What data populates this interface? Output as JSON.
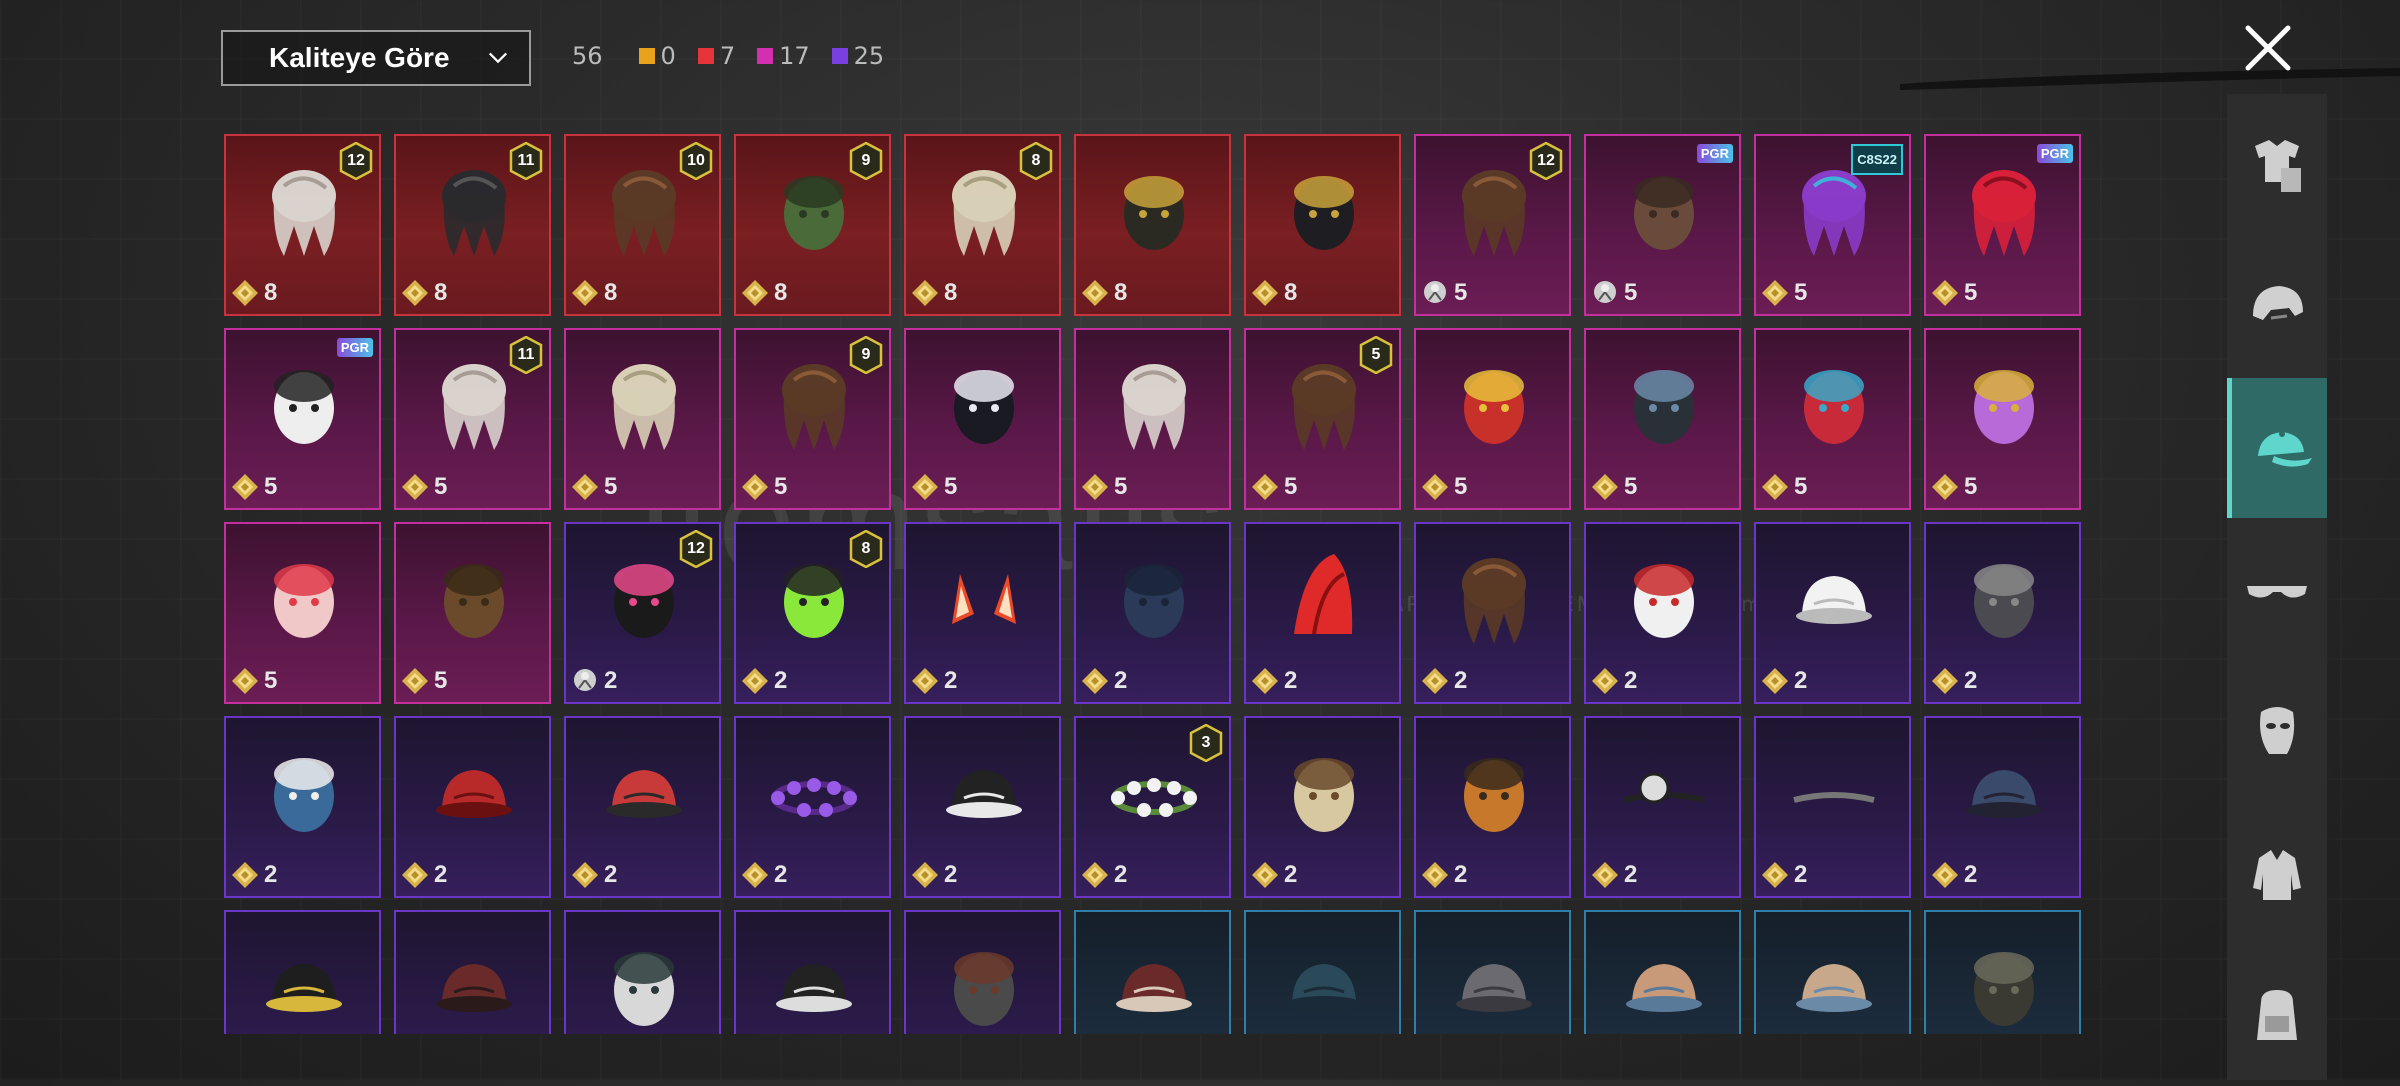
{
  "sort": {
    "label": "Kaliteye Göre"
  },
  "counts": {
    "total": "56",
    "items": [
      {
        "value": "0",
        "color": "#e8a21b"
      },
      {
        "value": "7",
        "color": "#e5353a"
      },
      {
        "value": "17",
        "color": "#d42fb0"
      },
      {
        "value": "25",
        "color": "#7a3fe0"
      }
    ]
  },
  "watermark": {
    "text": "itemsatis",
    "sub": "HESAP / SKIN / ITEM / E-PIN  .com"
  },
  "sidebar": [
    {
      "icon": "outfit-icon"
    },
    {
      "icon": "helmet-icon"
    },
    {
      "icon": "cap-icon",
      "active": true
    },
    {
      "icon": "glasses-icon"
    },
    {
      "icon": "mask-icon"
    },
    {
      "icon": "jacket-icon"
    },
    {
      "icon": "backpack-icon"
    }
  ],
  "grid": {
    "rows": [
      [
        {
          "q": "red",
          "cost": "8",
          "currency": "gold",
          "badge": "12",
          "art": "hair-white"
        },
        {
          "q": "red",
          "cost": "8",
          "currency": "gold",
          "badge": "11",
          "art": "hair-black"
        },
        {
          "q": "red",
          "cost": "8",
          "currency": "gold",
          "badge": "10",
          "art": "hair-brown"
        },
        {
          "q": "red",
          "cost": "8",
          "currency": "gold",
          "badge": "9",
          "art": "head-green"
        },
        {
          "q": "red",
          "cost": "8",
          "currency": "gold",
          "badge": "8",
          "art": "hair-blonde"
        },
        {
          "q": "red",
          "cost": "8",
          "currency": "gold",
          "art": "helmet-gold"
        },
        {
          "q": "red",
          "cost": "8",
          "currency": "gold",
          "art": "hat-tricorn"
        },
        {
          "q": "pink",
          "cost": "5",
          "currency": "silver",
          "badge": "12",
          "art": "hair-brown"
        },
        {
          "q": "pink",
          "cost": "5",
          "currency": "silver",
          "tag": "PGR",
          "tagType": "pgr",
          "art": "head-beast"
        },
        {
          "q": "pink",
          "cost": "5",
          "currency": "gold",
          "tag": "C8S22",
          "tagType": "cs",
          "art": "hair-purple"
        },
        {
          "q": "pink",
          "cost": "5",
          "currency": "gold",
          "tag": "PGR",
          "tagType": "pgr",
          "art": "hair-red"
        }
      ],
      [
        {
          "q": "pink",
          "cost": "5",
          "currency": "gold",
          "tag": "PGR",
          "tagType": "pgr",
          "art": "head-panda"
        },
        {
          "q": "pink",
          "cost": "5",
          "currency": "gold",
          "badge": "11",
          "art": "hair-white"
        },
        {
          "q": "pink",
          "cost": "5",
          "currency": "gold",
          "art": "hair-blonde"
        },
        {
          "q": "pink",
          "cost": "5",
          "currency": "gold",
          "badge": "9",
          "art": "hair-brown"
        },
        {
          "q": "pink",
          "cost": "5",
          "currency": "gold",
          "art": "helmet-spike"
        },
        {
          "q": "pink",
          "cost": "5",
          "currency": "gold",
          "art": "hair-white"
        },
        {
          "q": "pink",
          "cost": "5",
          "currency": "gold",
          "badge": "5",
          "art": "hair-brown"
        },
        {
          "q": "pink",
          "cost": "5",
          "currency": "gold",
          "art": "mask-dragon"
        },
        {
          "q": "pink",
          "cost": "5",
          "currency": "gold",
          "art": "helmet-dark"
        },
        {
          "q": "pink",
          "cost": "5",
          "currency": "gold",
          "art": "head-feather"
        },
        {
          "q": "pink",
          "cost": "5",
          "currency": "gold",
          "art": "hat-purple"
        }
      ],
      [
        {
          "q": "pink",
          "cost": "5",
          "currency": "gold",
          "art": "hat-cake"
        },
        {
          "q": "pink",
          "cost": "5",
          "currency": "gold",
          "art": "head-bear"
        },
        {
          "q": "purple",
          "cost": "2",
          "currency": "silver",
          "badge": "12",
          "art": "helmet-bunny"
        },
        {
          "q": "purple",
          "cost": "2",
          "currency": "gold",
          "badge": "8",
          "art": "head-alien"
        },
        {
          "q": "purple",
          "cost": "2",
          "currency": "gold",
          "art": "ears-red"
        },
        {
          "q": "purple",
          "cost": "2",
          "currency": "gold",
          "art": "beanie-blue"
        },
        {
          "q": "purple",
          "cost": "2",
          "currency": "gold",
          "art": "mohawk-red"
        },
        {
          "q": "purple",
          "cost": "2",
          "currency": "gold",
          "art": "hair-brown"
        },
        {
          "q": "purple",
          "cost": "2",
          "currency": "gold",
          "art": "mask-clown"
        },
        {
          "q": "purple",
          "cost": "2",
          "currency": "gold",
          "art": "visor-white"
        },
        {
          "q": "purple",
          "cost": "2",
          "currency": "gold",
          "art": "mask-grey"
        }
      ],
      [
        {
          "q": "purple",
          "cost": "2",
          "currency": "gold",
          "art": "hat-shark"
        },
        {
          "q": "purple",
          "cost": "2",
          "currency": "gold",
          "art": "beret-red"
        },
        {
          "q": "purple",
          "cost": "2",
          "currency": "gold",
          "art": "tophat-red"
        },
        {
          "q": "purple",
          "cost": "2",
          "currency": "gold",
          "art": "wreath-purple"
        },
        {
          "q": "purple",
          "cost": "2",
          "currency": "gold",
          "art": "cap-police"
        },
        {
          "q": "purple",
          "cost": "2",
          "currency": "gold",
          "badge": "3",
          "art": "wreath-white"
        },
        {
          "q": "purple",
          "cost": "2",
          "currency": "gold",
          "art": "hat-sundae"
        },
        {
          "q": "purple",
          "cost": "2",
          "currency": "gold",
          "art": "hat-burger"
        },
        {
          "q": "purple",
          "cost": "2",
          "currency": "gold",
          "art": "headlamp"
        },
        {
          "q": "purple",
          "cost": "2",
          "currency": "gold",
          "art": "headband"
        },
        {
          "q": "purple",
          "cost": "2",
          "currency": "gold",
          "art": "cap-navy"
        }
      ],
      [
        {
          "q": "purple",
          "art": "cap-black"
        },
        {
          "q": "purple",
          "art": "fedora-red"
        },
        {
          "q": "purple",
          "art": "helmet-check"
        },
        {
          "q": "purple",
          "art": "bucket-black"
        },
        {
          "q": "purple",
          "art": "aviator"
        },
        {
          "q": "blue",
          "art": "cap-maroon"
        },
        {
          "q": "blue",
          "art": "beret-blue"
        },
        {
          "q": "blue",
          "art": "flatcap-grey"
        },
        {
          "q": "blue",
          "art": "cap-trucker"
        },
        {
          "q": "blue",
          "art": "cap-trucker2"
        },
        {
          "q": "blue",
          "art": "helmet-camo"
        }
      ]
    ]
  }
}
